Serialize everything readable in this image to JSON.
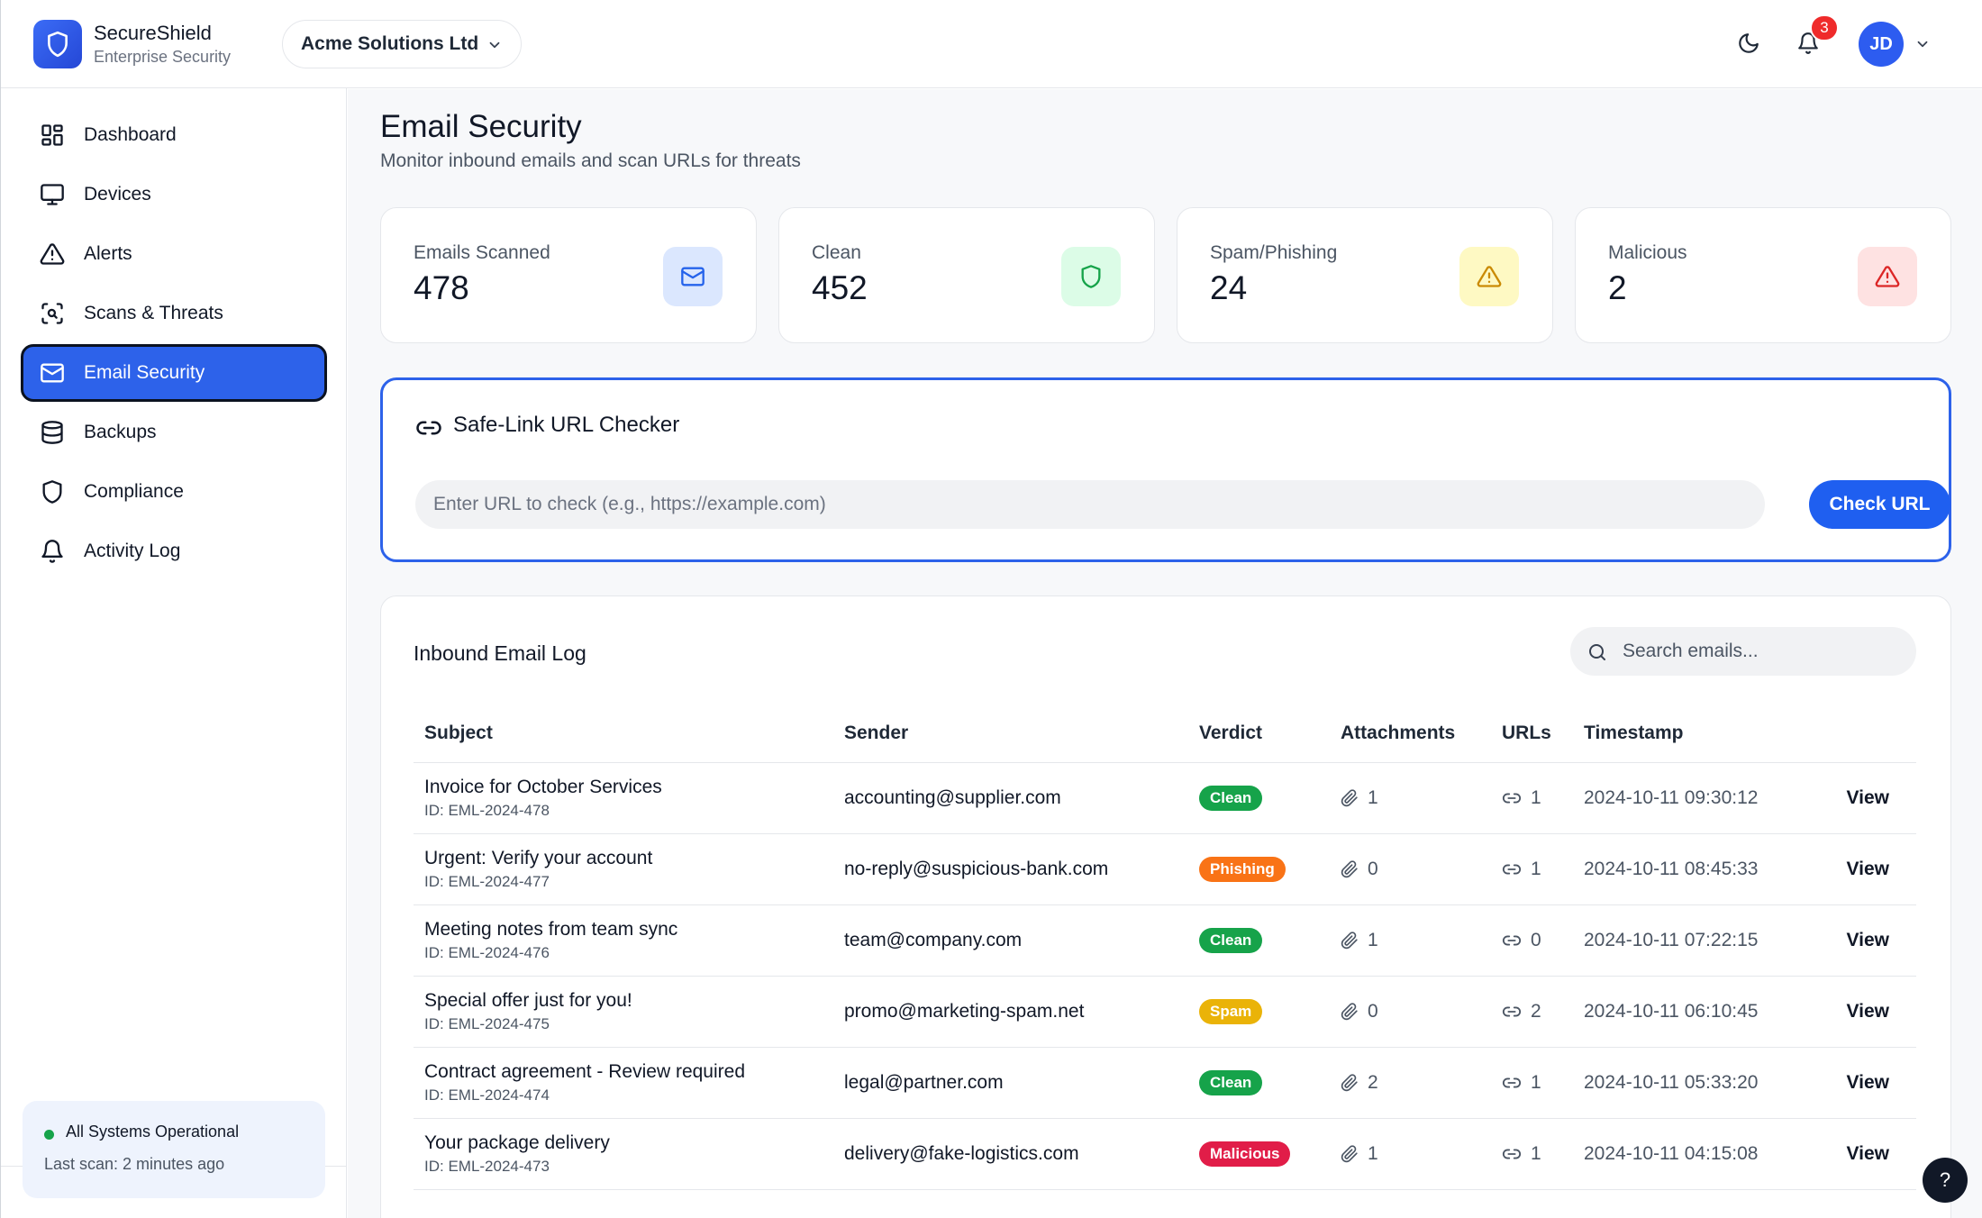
{
  "brand": {
    "name": "SecureShield",
    "subtitle": "Enterprise Security"
  },
  "org_selector": {
    "value": "Acme Solutions Ltd"
  },
  "header": {
    "notification_count": "3",
    "avatar_initials": "JD"
  },
  "sidebar": {
    "items": [
      {
        "label": "Dashboard",
        "icon": "dashboard-icon",
        "active": false
      },
      {
        "label": "Devices",
        "icon": "monitor-icon",
        "active": false
      },
      {
        "label": "Alerts",
        "icon": "alert-triangle-icon",
        "active": false
      },
      {
        "label": "Scans & Threats",
        "icon": "scan-icon",
        "active": false
      },
      {
        "label": "Email Security",
        "icon": "mail-icon",
        "active": true
      },
      {
        "label": "Backups",
        "icon": "database-icon",
        "active": false
      },
      {
        "label": "Compliance",
        "icon": "shield-icon",
        "active": false
      },
      {
        "label": "Activity Log",
        "icon": "bell-icon",
        "active": false
      }
    ],
    "status": {
      "title": "All Systems Operational",
      "subtitle": "Last scan: 2 minutes ago"
    }
  },
  "page": {
    "title": "Email Security",
    "subtitle": "Monitor inbound emails and scan URLs for threats"
  },
  "stats": [
    {
      "label": "Emails Scanned",
      "value": "478",
      "icon": "mail-icon",
      "color": "#2563eb",
      "bg": "#dbe7fe"
    },
    {
      "label": "Clean",
      "value": "452",
      "icon": "shield-icon",
      "color": "#16a34a",
      "bg": "#dcfce7"
    },
    {
      "label": "Spam/Phishing",
      "value": "24",
      "icon": "alert-triangle-icon",
      "color": "#ca8a04",
      "bg": "#fef9c3"
    },
    {
      "label": "Malicious",
      "value": "2",
      "icon": "alert-triangle-icon",
      "color": "#dc2626",
      "bg": "#fee2e2"
    }
  ],
  "url_checker": {
    "title": "Safe-Link URL Checker",
    "placeholder": "Enter URL to check (e.g., https://example.com)",
    "button_label": "Check URL"
  },
  "email_log": {
    "title": "Inbound Email Log",
    "search_placeholder": "Search emails...",
    "columns": [
      "Subject",
      "Sender",
      "Verdict",
      "Attachments",
      "URLs",
      "Timestamp"
    ],
    "rows": [
      {
        "subject": "Invoice for October Services",
        "id": "ID: EML-2024-478",
        "sender": "accounting@supplier.com",
        "verdict": "Clean",
        "verdict_color": "#16a34a",
        "attachments": "1",
        "urls": "1",
        "timestamp": "2024-10-11 09:30:12",
        "action": "View"
      },
      {
        "subject": "Urgent: Verify your account",
        "id": "ID: EML-2024-477",
        "sender": "no-reply@suspicious-bank.com",
        "verdict": "Phishing",
        "verdict_color": "#f97316",
        "attachments": "0",
        "urls": "1",
        "timestamp": "2024-10-11 08:45:33",
        "action": "View"
      },
      {
        "subject": "Meeting notes from team sync",
        "id": "ID: EML-2024-476",
        "sender": "team@company.com",
        "verdict": "Clean",
        "verdict_color": "#16a34a",
        "attachments": "1",
        "urls": "0",
        "timestamp": "2024-10-11 07:22:15",
        "action": "View"
      },
      {
        "subject": "Special offer just for you!",
        "id": "ID: EML-2024-475",
        "sender": "promo@marketing-spam.net",
        "verdict": "Spam",
        "verdict_color": "#eab308",
        "attachments": "0",
        "urls": "2",
        "timestamp": "2024-10-11 06:10:45",
        "action": "View"
      },
      {
        "subject": "Contract agreement - Review required",
        "id": "ID: EML-2024-474",
        "sender": "legal@partner.com",
        "verdict": "Clean",
        "verdict_color": "#16a34a",
        "attachments": "2",
        "urls": "1",
        "timestamp": "2024-10-11 05:33:20",
        "action": "View"
      },
      {
        "subject": "Your package delivery",
        "id": "ID: EML-2024-473",
        "sender": "delivery@fake-logistics.com",
        "verdict": "Malicious",
        "verdict_color": "#e11d48",
        "attachments": "1",
        "urls": "1",
        "timestamp": "2024-10-11 04:15:08",
        "action": "View"
      }
    ]
  },
  "help": {
    "label": "?"
  }
}
